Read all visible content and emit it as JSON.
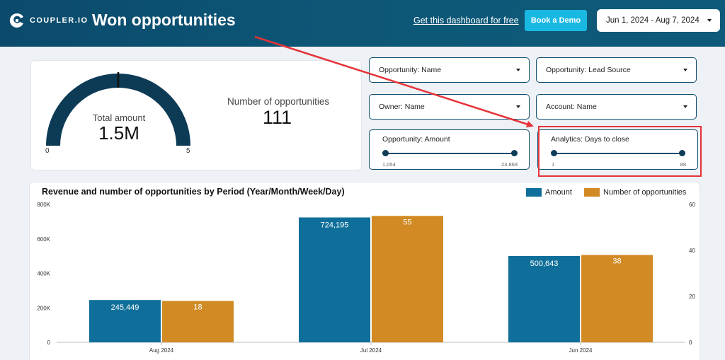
{
  "header": {
    "logo_text": "COUPLER.IO",
    "title": "Won opportunities",
    "get_dashboard_link": "Get this dashboard for free",
    "book_demo_label": "Book a Demo",
    "date_range": "Jun 1, 2024 - Aug 7, 2024"
  },
  "kpis": {
    "gauge_label": "Total amount",
    "gauge_value": "1.5M",
    "gauge_min": "0",
    "gauge_max": "5",
    "count_label": "Number of opportunities",
    "count_value": "111"
  },
  "filters": {
    "opportunity_name": "Opportunity: Name",
    "lead_source": "Opportunity: Lead Source",
    "owner_name": "Owner: Name",
    "account_name": "Account: Name"
  },
  "sliders": {
    "amount": {
      "label": "Opportunity: Amount",
      "min": "1,054",
      "max": "24,868"
    },
    "days_to_close": {
      "label": "Analytics: Days to close",
      "min": "1",
      "max": "88"
    }
  },
  "colors": {
    "amount": "#0f6f9a",
    "count": "#d18a24",
    "accent": "#19b8e3",
    "highlight": "#e5333a"
  },
  "chart_data": {
    "type": "bar",
    "title": "Revenue and number of opportunities by Period (Year/Month/Week/Day)",
    "categories": [
      "Aug 2024",
      "Jul 2024",
      "Jun 2024"
    ],
    "series": [
      {
        "name": "Amount",
        "axis": "left",
        "values": [
          245449,
          724195,
          500643
        ],
        "labels": [
          "245,449",
          "724,195",
          "500,643"
        ]
      },
      {
        "name": "Number of opportunities",
        "axis": "right",
        "values": [
          18,
          55,
          38
        ],
        "labels": [
          "18",
          "55",
          "38"
        ]
      }
    ],
    "y_left_ticks": [
      "0",
      "200K",
      "400K",
      "600K",
      "800K"
    ],
    "y_left_range": [
      0,
      800000
    ],
    "y_right_ticks": [
      "0",
      "20",
      "40",
      "60"
    ],
    "y_right_range": [
      0,
      60
    ],
    "legend_position": "top-right"
  }
}
